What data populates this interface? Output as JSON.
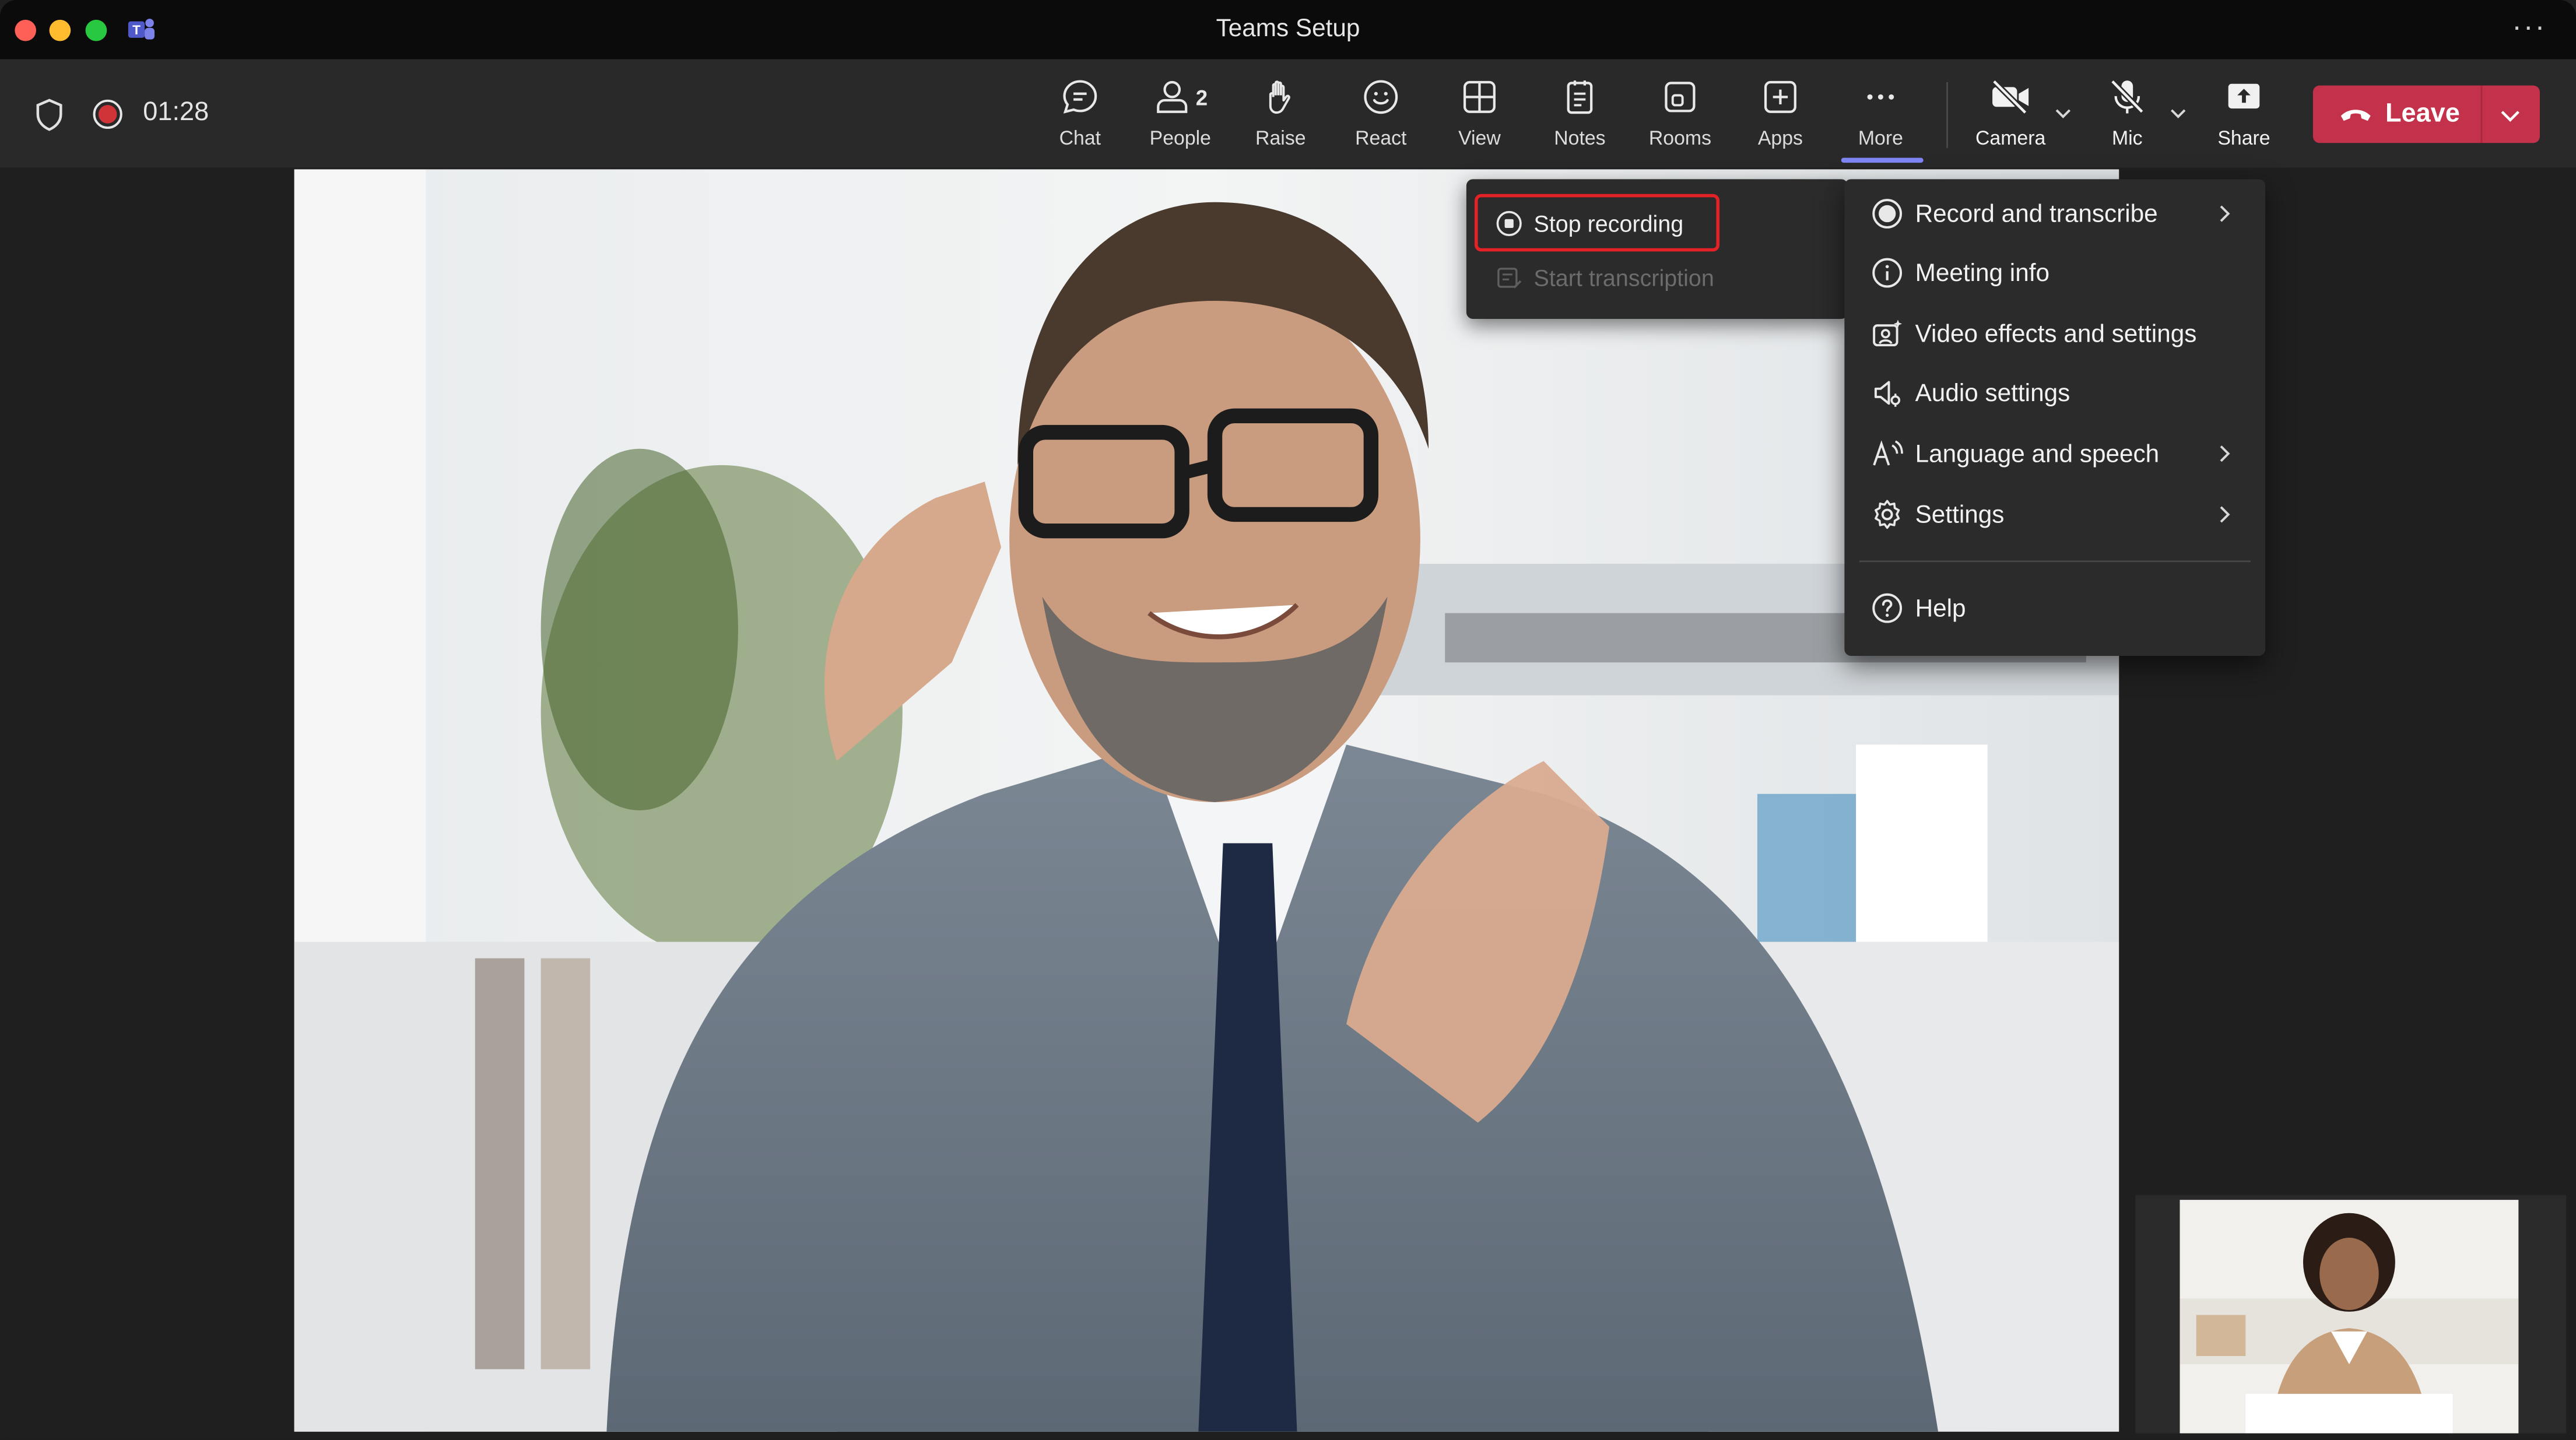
{
  "window": {
    "title": "Teams Setup",
    "more_icon": "more-horizontal-icon"
  },
  "meeting": {
    "timer": "01:28",
    "recording": true
  },
  "toolbar": {
    "chat_label": "Chat",
    "people_label": "People",
    "people_count": "2",
    "raise_label": "Raise",
    "react_label": "React",
    "view_label": "View",
    "notes_label": "Notes",
    "rooms_label": "Rooms",
    "apps_label": "Apps",
    "more_label": "More",
    "camera_label": "Camera",
    "mic_label": "Mic",
    "share_label": "Share",
    "leave_label": "Leave"
  },
  "record_submenu": {
    "stop_recording": "Stop recording",
    "start_transcription": "Start transcription"
  },
  "more_menu": {
    "items": [
      {
        "label": "Record and transcribe",
        "icon": "record-icon",
        "has_submenu": true
      },
      {
        "label": "Meeting info",
        "icon": "info-icon",
        "has_submenu": false
      },
      {
        "label": "Video effects and settings",
        "icon": "video-effects-icon",
        "has_submenu": false
      },
      {
        "label": "Audio settings",
        "icon": "speaker-settings-icon",
        "has_submenu": false
      },
      {
        "label": "Language and speech",
        "icon": "language-icon",
        "has_submenu": true
      },
      {
        "label": "Settings",
        "icon": "gear-icon",
        "has_submenu": true
      },
      {
        "label": "Help",
        "icon": "help-icon",
        "has_submenu": false
      }
    ]
  },
  "colors": {
    "leave": "#c4314b",
    "accent": "#7f85f5",
    "highlight": "#e32227",
    "recording": "#d13438"
  }
}
